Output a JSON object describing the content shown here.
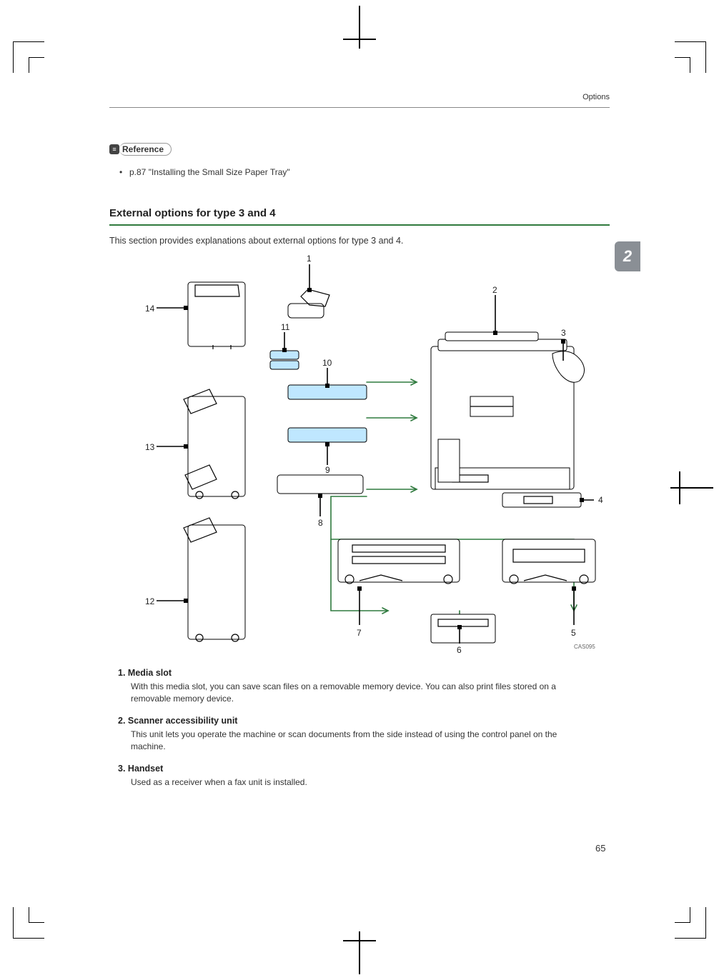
{
  "header": {
    "right": "Options"
  },
  "reference": {
    "icon_label": "≡",
    "label": "Reference",
    "bullet": "p.87 \"Installing the Small Size Paper Tray\""
  },
  "section": {
    "heading": "External options for type 3 and 4",
    "intro": "This section provides explanations about external options for type 3 and 4."
  },
  "side_tab": "2",
  "diagram_labels": {
    "n1": "1",
    "n2": "2",
    "n3": "3",
    "n4": "4",
    "n5": "5",
    "n6": "6",
    "n7": "7",
    "n8": "8",
    "n9": "9",
    "n10": "10",
    "n11": "11",
    "n12": "12",
    "n13": "13",
    "n14": "14",
    "code": "CAS095"
  },
  "definitions": [
    {
      "num": "1.",
      "title": "Media slot",
      "body": "With this media slot, you can save scan files on a removable memory device. You can also print files stored on a removable memory device."
    },
    {
      "num": "2.",
      "title": "Scanner accessibility unit",
      "body": "This unit lets you operate the machine or scan documents from the side instead of using the control panel on the machine."
    },
    {
      "num": "3.",
      "title": "Handset",
      "body": "Used as a receiver when a fax unit is installed."
    }
  ],
  "page_number": "65"
}
